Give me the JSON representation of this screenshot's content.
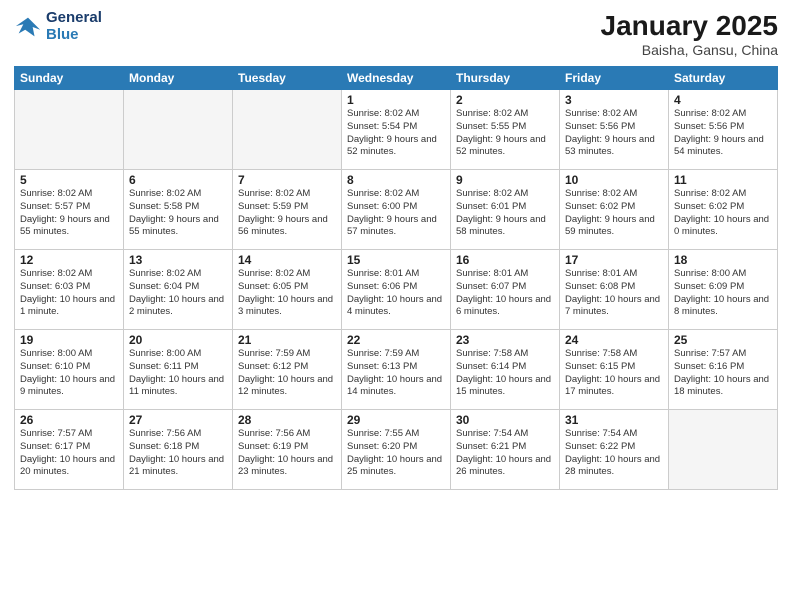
{
  "header": {
    "logo_line1": "General",
    "logo_line2": "Blue",
    "month_title": "January 2025",
    "location": "Baisha, Gansu, China"
  },
  "weekdays": [
    "Sunday",
    "Monday",
    "Tuesday",
    "Wednesday",
    "Thursday",
    "Friday",
    "Saturday"
  ],
  "weeks": [
    [
      {
        "day": "",
        "info": ""
      },
      {
        "day": "",
        "info": ""
      },
      {
        "day": "",
        "info": ""
      },
      {
        "day": "1",
        "info": "Sunrise: 8:02 AM\nSunset: 5:54 PM\nDaylight: 9 hours and 52 minutes."
      },
      {
        "day": "2",
        "info": "Sunrise: 8:02 AM\nSunset: 5:55 PM\nDaylight: 9 hours and 52 minutes."
      },
      {
        "day": "3",
        "info": "Sunrise: 8:02 AM\nSunset: 5:56 PM\nDaylight: 9 hours and 53 minutes."
      },
      {
        "day": "4",
        "info": "Sunrise: 8:02 AM\nSunset: 5:56 PM\nDaylight: 9 hours and 54 minutes."
      }
    ],
    [
      {
        "day": "5",
        "info": "Sunrise: 8:02 AM\nSunset: 5:57 PM\nDaylight: 9 hours and 55 minutes."
      },
      {
        "day": "6",
        "info": "Sunrise: 8:02 AM\nSunset: 5:58 PM\nDaylight: 9 hours and 55 minutes."
      },
      {
        "day": "7",
        "info": "Sunrise: 8:02 AM\nSunset: 5:59 PM\nDaylight: 9 hours and 56 minutes."
      },
      {
        "day": "8",
        "info": "Sunrise: 8:02 AM\nSunset: 6:00 PM\nDaylight: 9 hours and 57 minutes."
      },
      {
        "day": "9",
        "info": "Sunrise: 8:02 AM\nSunset: 6:01 PM\nDaylight: 9 hours and 58 minutes."
      },
      {
        "day": "10",
        "info": "Sunrise: 8:02 AM\nSunset: 6:02 PM\nDaylight: 9 hours and 59 minutes."
      },
      {
        "day": "11",
        "info": "Sunrise: 8:02 AM\nSunset: 6:02 PM\nDaylight: 10 hours and 0 minutes."
      }
    ],
    [
      {
        "day": "12",
        "info": "Sunrise: 8:02 AM\nSunset: 6:03 PM\nDaylight: 10 hours and 1 minute."
      },
      {
        "day": "13",
        "info": "Sunrise: 8:02 AM\nSunset: 6:04 PM\nDaylight: 10 hours and 2 minutes."
      },
      {
        "day": "14",
        "info": "Sunrise: 8:02 AM\nSunset: 6:05 PM\nDaylight: 10 hours and 3 minutes."
      },
      {
        "day": "15",
        "info": "Sunrise: 8:01 AM\nSunset: 6:06 PM\nDaylight: 10 hours and 4 minutes."
      },
      {
        "day": "16",
        "info": "Sunrise: 8:01 AM\nSunset: 6:07 PM\nDaylight: 10 hours and 6 minutes."
      },
      {
        "day": "17",
        "info": "Sunrise: 8:01 AM\nSunset: 6:08 PM\nDaylight: 10 hours and 7 minutes."
      },
      {
        "day": "18",
        "info": "Sunrise: 8:00 AM\nSunset: 6:09 PM\nDaylight: 10 hours and 8 minutes."
      }
    ],
    [
      {
        "day": "19",
        "info": "Sunrise: 8:00 AM\nSunset: 6:10 PM\nDaylight: 10 hours and 9 minutes."
      },
      {
        "day": "20",
        "info": "Sunrise: 8:00 AM\nSunset: 6:11 PM\nDaylight: 10 hours and 11 minutes."
      },
      {
        "day": "21",
        "info": "Sunrise: 7:59 AM\nSunset: 6:12 PM\nDaylight: 10 hours and 12 minutes."
      },
      {
        "day": "22",
        "info": "Sunrise: 7:59 AM\nSunset: 6:13 PM\nDaylight: 10 hours and 14 minutes."
      },
      {
        "day": "23",
        "info": "Sunrise: 7:58 AM\nSunset: 6:14 PM\nDaylight: 10 hours and 15 minutes."
      },
      {
        "day": "24",
        "info": "Sunrise: 7:58 AM\nSunset: 6:15 PM\nDaylight: 10 hours and 17 minutes."
      },
      {
        "day": "25",
        "info": "Sunrise: 7:57 AM\nSunset: 6:16 PM\nDaylight: 10 hours and 18 minutes."
      }
    ],
    [
      {
        "day": "26",
        "info": "Sunrise: 7:57 AM\nSunset: 6:17 PM\nDaylight: 10 hours and 20 minutes."
      },
      {
        "day": "27",
        "info": "Sunrise: 7:56 AM\nSunset: 6:18 PM\nDaylight: 10 hours and 21 minutes."
      },
      {
        "day": "28",
        "info": "Sunrise: 7:56 AM\nSunset: 6:19 PM\nDaylight: 10 hours and 23 minutes."
      },
      {
        "day": "29",
        "info": "Sunrise: 7:55 AM\nSunset: 6:20 PM\nDaylight: 10 hours and 25 minutes."
      },
      {
        "day": "30",
        "info": "Sunrise: 7:54 AM\nSunset: 6:21 PM\nDaylight: 10 hours and 26 minutes."
      },
      {
        "day": "31",
        "info": "Sunrise: 7:54 AM\nSunset: 6:22 PM\nDaylight: 10 hours and 28 minutes."
      },
      {
        "day": "",
        "info": ""
      }
    ]
  ]
}
